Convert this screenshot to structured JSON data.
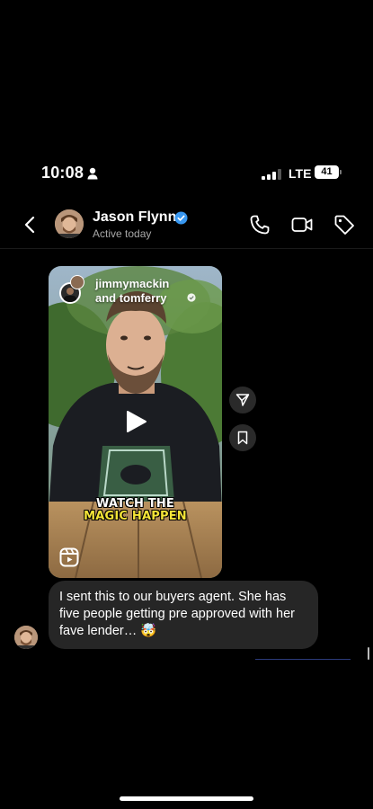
{
  "status": {
    "time": "10:08",
    "network": "LTE",
    "battery": "41"
  },
  "header": {
    "contact_name": "Jason Flynn",
    "presence": "Active today"
  },
  "reel": {
    "author_line1": "jimmymackin",
    "author_line2": "and tomferry",
    "caption_line1": "WATCH THE",
    "caption_line2": "MAGIC HAPPEN"
  },
  "message": {
    "text": "I sent this to our buyers agent. She has five people getting pre approved with her fave lender… 🤯"
  },
  "colors": {
    "background": "#000000",
    "bubble": "#262626",
    "verified": "#3897f0",
    "caption_highlight": "#f3e437"
  },
  "icons": {
    "back": "chevron-left-icon",
    "call": "phone-icon",
    "video": "video-camera-icon",
    "tag": "tag-icon",
    "share": "send-icon",
    "save": "bookmark-icon",
    "play": "play-icon",
    "reels": "reels-icon"
  }
}
